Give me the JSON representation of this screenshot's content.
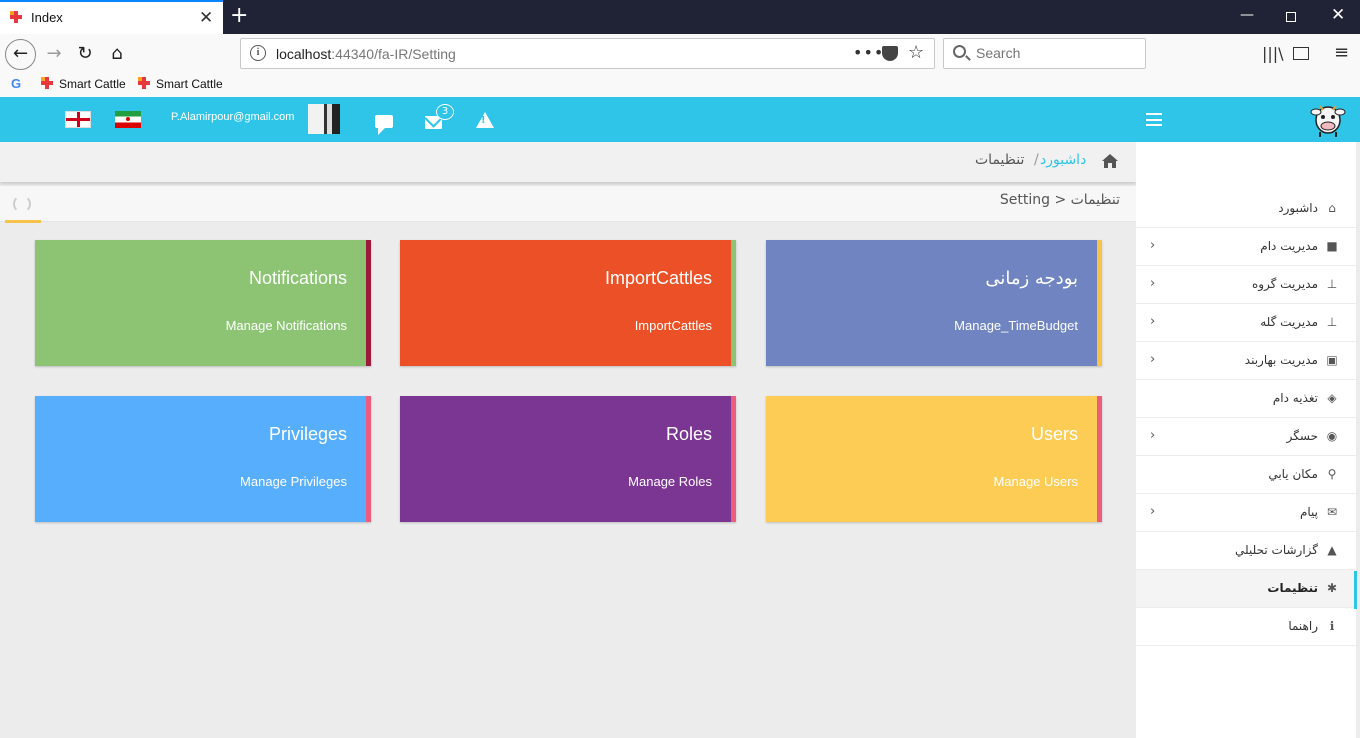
{
  "browser": {
    "tab_title": "Index",
    "new_tab": "+",
    "url_host": "localhost",
    "url_rest": ":44340/fa-IR/Setting",
    "search_placeholder": "Search",
    "bookmarks": [
      "Smart Cattle",
      "Smart Cattle"
    ],
    "google_letter": "G"
  },
  "header": {
    "email": "P.Alamirpour@gmail.com",
    "mail_count": "3"
  },
  "breadcrumb": {
    "home": "داشبورد",
    "separator": "/",
    "current": "تنظیمات"
  },
  "panel": {
    "heading": "تنظیمات < Setting"
  },
  "cards": [
    {
      "title": "Notifications",
      "link": "Manage Notifications",
      "color": "#8cc474",
      "stripe": "#9c1b3c"
    },
    {
      "title": "ImportCattles",
      "link": "ImportCattles",
      "color": "#ec5027",
      "stripe": "#8cc474"
    },
    {
      "title": "بودجه زمانی",
      "link": "Manage_TimeBudget",
      "color": "#6f84c1",
      "stripe": "#f8c34a"
    },
    {
      "title": "Privileges",
      "link": "Manage Privileges",
      "color": "#57aefc",
      "stripe": "#ec5c7c"
    },
    {
      "title": "Roles",
      "link": "Manage Roles",
      "color": "#7b3593",
      "stripe": "#ec5c7c"
    },
    {
      "title": "Users",
      "link": "Manage Users",
      "color": "#fdcc55",
      "stripe": "#ec5c7c"
    }
  ],
  "sidebar": {
    "items": [
      {
        "label": "داشبورد",
        "icon": "home-icon",
        "glyph": "⌂",
        "chevron": ""
      },
      {
        "label": "مدیریت دام",
        "icon": "cattle-icon",
        "glyph": "■",
        "chevron": "›"
      },
      {
        "label": "مدیریت گروه",
        "icon": "sitemap-icon",
        "glyph": "⊥",
        "chevron": "›"
      },
      {
        "label": "مدیریت گله",
        "icon": "sitemap-icon",
        "glyph": "⊥",
        "chevron": "›"
      },
      {
        "label": "مدیریت بهاربند",
        "icon": "barn-icon",
        "glyph": "▣",
        "chevron": "›"
      },
      {
        "label": "تغذیه دام",
        "icon": "leaf-icon",
        "glyph": "◈",
        "chevron": ""
      },
      {
        "label": "حسگر",
        "icon": "sensor-icon",
        "glyph": "◉",
        "chevron": "›"
      },
      {
        "label": "مکان يابي",
        "icon": "location-icon",
        "glyph": "⚲",
        "chevron": ""
      },
      {
        "label": "پیام",
        "icon": "envelope-icon",
        "glyph": "✉",
        "chevron": "›"
      },
      {
        "label": "گزارشات تحليلي",
        "icon": "area-chart-icon",
        "glyph": "▲",
        "chevron": ""
      },
      {
        "label": "تنظیمات",
        "icon": "cog-icon",
        "glyph": "✱",
        "chevron": "",
        "active": true
      },
      {
        "label": "راهنما",
        "icon": "info-icon",
        "glyph": "ℹ",
        "chevron": ""
      }
    ]
  }
}
